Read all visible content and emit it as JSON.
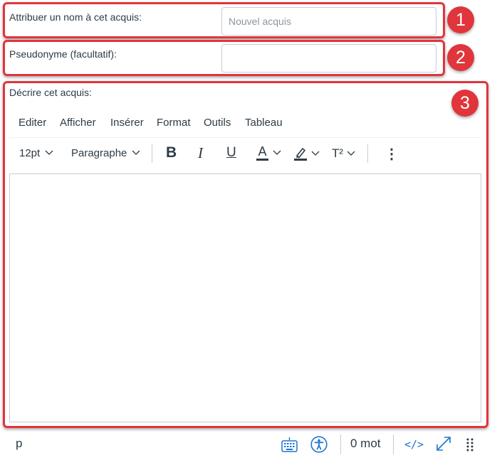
{
  "fields": {
    "name": {
      "label": "Attribuer un nom à cet acquis:",
      "placeholder": "Nouvel acquis",
      "value": ""
    },
    "pseudonym": {
      "label": "Pseudonyme (facultatif):",
      "value": ""
    },
    "description": {
      "label": "Décrire cet acquis:"
    }
  },
  "badges": [
    "1",
    "2",
    "3"
  ],
  "editor": {
    "menu": [
      "Editer",
      "Afficher",
      "Insérer",
      "Format",
      "Outils",
      "Tableau"
    ],
    "toolbar": {
      "font_size": "12pt",
      "block_format": "Paragraphe",
      "bold_label": "B",
      "italic_label": "I",
      "underline_label": "U",
      "text_color_label": "A",
      "superscript_label": "T²",
      "more_label": "⋮"
    },
    "statusbar": {
      "path": "p",
      "word_count": "0 mot",
      "html_label": "</>"
    }
  },
  "colors": {
    "highlight": "#e0353b",
    "link_blue": "#1b75d0",
    "text": "#2d3b45"
  }
}
